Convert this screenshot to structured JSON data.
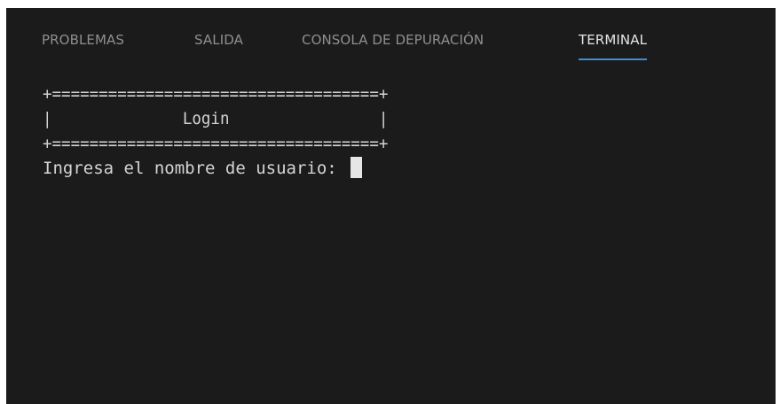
{
  "tabs": [
    {
      "label": "PROBLEMAS"
    },
    {
      "label": "SALIDA"
    },
    {
      "label": "CONSOLA DE DEPURACIÓN"
    },
    {
      "label": "TERMINAL",
      "active": true
    }
  ],
  "terminal": {
    "lines": [
      "+===================================+",
      "|              Login                |",
      "+===================================+",
      "Ingresa el nombre de usuario: "
    ]
  },
  "colors": {
    "panel_bg": "#1b1b1b",
    "active_tab_underline": "#3c8ed8",
    "text": "#d4d4d4",
    "inactive_tab_text": "#8f8f8f"
  }
}
